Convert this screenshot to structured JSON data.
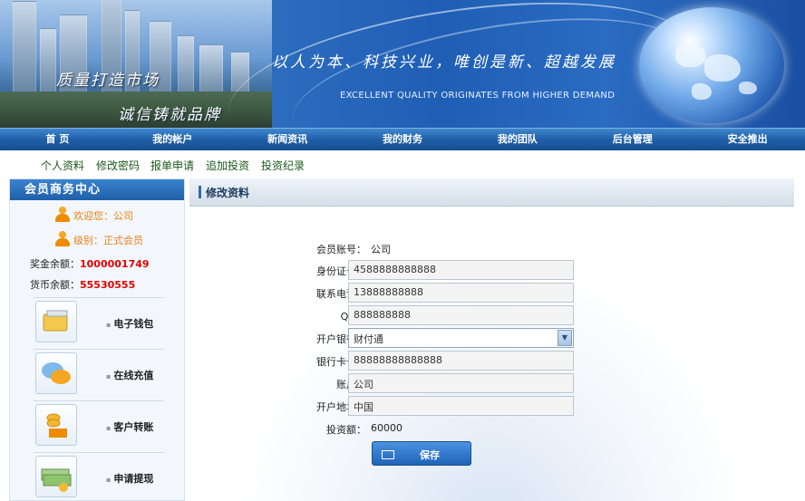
{
  "banner": {
    "slogan_1": "质量打造市场",
    "slogan_2": "诚信铸就品牌",
    "motto": "以人为本、科技兴业，唯创是新、超越发展",
    "motto_en": "EXCELLENT QUALITY ORIGINATES FROM HIGHER DEMAND"
  },
  "nav": {
    "items": [
      "首  页",
      "我的帐户",
      "新闻资讯",
      "我的财务",
      "我的团队",
      "后台管理",
      "安全推出"
    ]
  },
  "subnav": {
    "items": [
      "个人资料",
      "修改密码",
      "报单申请",
      "追加投资",
      "投资纪录"
    ]
  },
  "sidebar": {
    "title": "会员商务中心",
    "welcome": "欢迎您：公司",
    "level": "级别：正式会员",
    "bonus_label": "奖金余额：",
    "bonus_value": "1000001749",
    "currency_label": "货币余额：",
    "currency_value": "55530555",
    "functions": [
      {
        "label": "电子钱包",
        "icon": "wallet-icon"
      },
      {
        "label": "在线充值",
        "icon": "chat-bubbles-icon"
      },
      {
        "label": "客户转账",
        "icon": "coins-icon"
      },
      {
        "label": "申请提现",
        "icon": "cash-stack-icon"
      }
    ]
  },
  "panel": {
    "title": "修改资料",
    "fields": {
      "account_label": "会员账号：",
      "account_value": "公司",
      "id_label": "身份证号：",
      "id_value": "4588888888888",
      "phone_label": "联系电话：",
      "phone_value": "13888888888",
      "qq_label": "QQ：",
      "qq_value": "888888888",
      "bank_label": "开户银行：",
      "bank_value": "财付通",
      "card_label": "银行卡号：",
      "card_value": "88888888888888",
      "holder_label": "账户：",
      "holder_value": "公司",
      "address_label": "开户地址：",
      "address_value": "中国",
      "invest_label": "投资额：",
      "invest_value": "60000"
    },
    "save_label": "保存"
  }
}
